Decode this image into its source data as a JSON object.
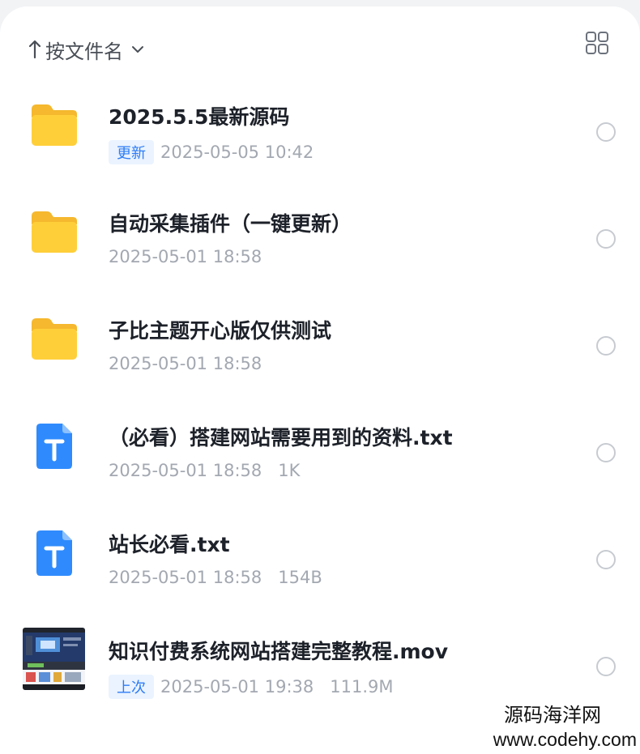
{
  "sort": {
    "label": "按文件名"
  },
  "colors": {
    "accent": "#2e7cf6",
    "badge_bg": "#eaf3ff",
    "folder": "#ffcc33",
    "txt_icon": "#2f8bfd",
    "meta_text": "#a3a8b1",
    "title_text": "#1d2129"
  },
  "files": [
    {
      "icon": "folder-icon",
      "name": "2025.5.5最新源码",
      "badge": "更新",
      "date": "2025-05-05 10:42",
      "size": ""
    },
    {
      "icon": "folder-icon",
      "name": "自动采集插件（一键更新）",
      "badge": "",
      "date": "2025-05-01 18:58",
      "size": ""
    },
    {
      "icon": "folder-icon",
      "name": "子比主题开心版仅供测试",
      "badge": "",
      "date": "2025-05-01 18:58",
      "size": ""
    },
    {
      "icon": "txt-file-icon",
      "name": "（必看）搭建网站需要用到的资料.txt",
      "badge": "",
      "date": "2025-05-01 18:58",
      "size": "1K"
    },
    {
      "icon": "txt-file-icon",
      "name": "站长必看.txt",
      "badge": "",
      "date": "2025-05-01 18:58",
      "size": "154B"
    },
    {
      "icon": "video-thumbnail",
      "name": "知识付费系统网站搭建完整教程.mov",
      "badge": "上次",
      "date": "2025-05-01 19:38",
      "size": "111.9M"
    }
  ],
  "watermark": {
    "line1": "源码海洋网",
    "line2": "www.codehy.com"
  }
}
